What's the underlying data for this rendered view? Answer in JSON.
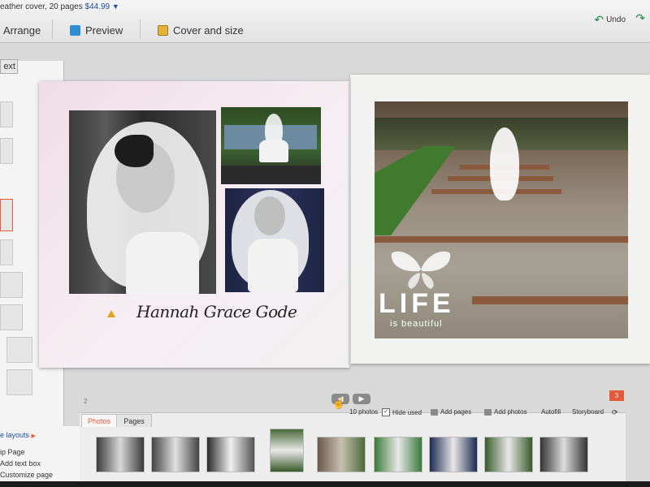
{
  "header": {
    "product_text": "eather cover, 20 pages",
    "price": "$44.99",
    "caret": "▼",
    "tabs": [
      {
        "label": "Arrange",
        "icon": ""
      },
      {
        "label": "Preview",
        "icon": "preview-icon"
      },
      {
        "label": "Cover and size",
        "icon": "cover-icon"
      }
    ],
    "undo_label": "Undo",
    "undo_icon": "undo-icon",
    "redo_icon": "redo-icon"
  },
  "left_panel": {
    "next_label": "ext",
    "menu": [
      "e layouts",
      "ip Page",
      "Add text box",
      "Customize page"
    ]
  },
  "spread": {
    "caption": "Hannah Grace Gode",
    "right_text_main": "LIFE",
    "right_text_sub": "is beautiful",
    "warning_icon": "warning-icon",
    "butterfly_icon": "butterfly-icon"
  },
  "navigation": {
    "page_number": "2",
    "page_badge": "3",
    "prev_icon": "arrow-left-icon",
    "next_icon": "arrow-right-icon"
  },
  "tray": {
    "tabs": [
      "Photos",
      "Pages"
    ],
    "photo_count": "10 photos",
    "hide_used": "Hide used",
    "hide_used_checked": "✓",
    "add_pages": "Add pages",
    "add_photos": "Add photos",
    "autofill": "Autofill",
    "storyboard": "Storyboard"
  },
  "colors": {
    "accent": "#e35b3a",
    "link": "#1f4fa0",
    "undo_green": "#1c8a3f"
  }
}
